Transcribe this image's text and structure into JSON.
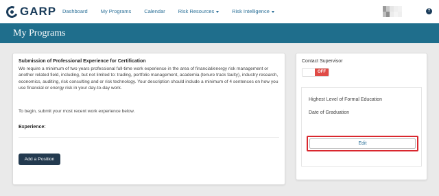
{
  "brand": {
    "logo_text": "GARP",
    "logo_color": "#1a3c5a"
  },
  "nav": {
    "items": [
      {
        "label": "Dashboard",
        "dropdown": false
      },
      {
        "label": "My Programs",
        "dropdown": false
      },
      {
        "label": "Calendar",
        "dropdown": false
      },
      {
        "label": "Risk Resources",
        "dropdown": true
      },
      {
        "label": "Risk Intelligence",
        "dropdown": true
      }
    ],
    "help_icon": "?"
  },
  "banner": {
    "title": "My Programs",
    "color": "#1f6e8c"
  },
  "main": {
    "heading": "Submission of Professional Experience for Certification",
    "description": "We require a minimum of two years professional full-time work experience in the area of financial/energy risk management or another related field, including, but not limited to: trading, portfolio management, academia (tenure track faulty), industry research, economics, auditing, risk consulting and or risk technology. Your description should include a minimum of 4 sentences on how you use financial or energy risk in your day-to-day work.",
    "begin_text": "To begin, submit your most recent work experience below.",
    "experience_label": "Experience:",
    "add_button": "Add a Position"
  },
  "side": {
    "contact_label": "Contact Supervisor",
    "toggle_state": "OFF",
    "education_label": "Highest Level of Formal Education",
    "graduation_label": "Date of Graduation",
    "edit_button": "Edit"
  },
  "colors": {
    "toggle_off": "#e04b46",
    "add_button_bg": "#233a4f",
    "highlight": "#d9272e"
  }
}
